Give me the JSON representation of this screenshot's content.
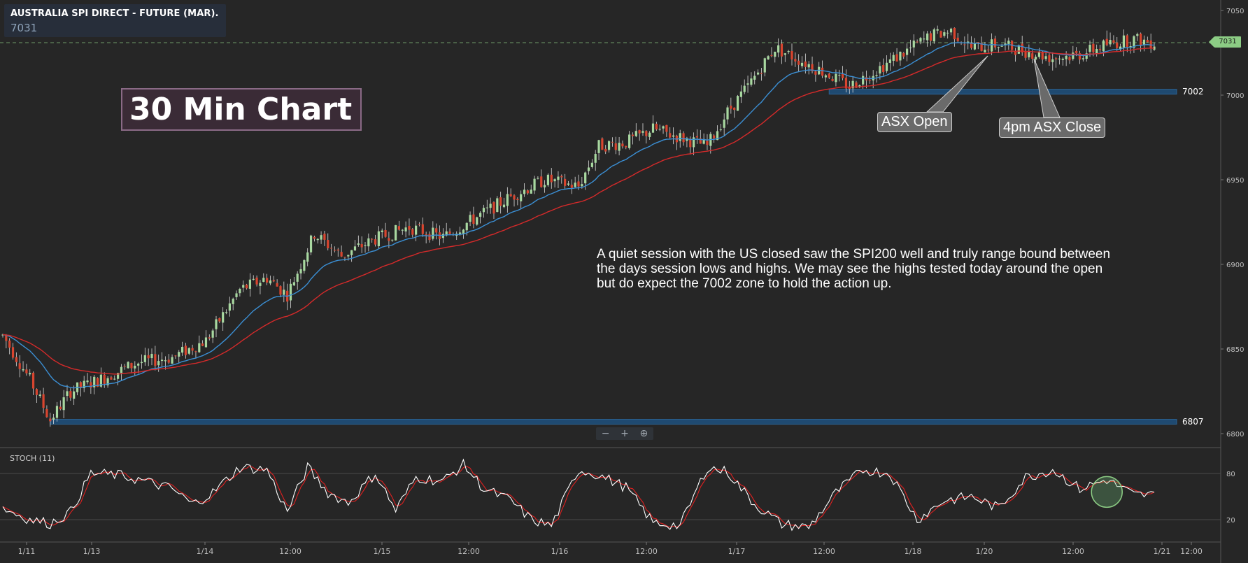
{
  "header": {
    "title": "AUSTRALIA SPI DIRECT - FUTURE (MAR).",
    "last_price": "7031"
  },
  "annotations": {
    "chart_label": "30 Min Chart",
    "commentary": [
      "A quiet session with the US closed saw the SPI200 well and truly range bound between",
      "the days session lows and highs. We may see the highs tested today around the open",
      "but do expect the 7002 zone to hold the action up."
    ],
    "asx_open": "ASX Open",
    "asx_close": "4pm ASX Close",
    "level_upper": "7002",
    "level_lower": "6807",
    "price_tag": "7031"
  },
  "zoom": {
    "minus": "−",
    "plus": "+",
    "magnify": "⊕"
  },
  "stoch": {
    "label": "STOCH (11)"
  },
  "colors": {
    "background": "#262626",
    "bull_candle": "#a8d8a0",
    "bear_candle": "#d9452f",
    "ema_fast": "#3b8fd4",
    "ema_slow": "#d42a2a",
    "stoch_k": "#ffffff",
    "stoch_d": "#e02020",
    "zone": "#1f4f7a",
    "last_price_line": "#8ccc84"
  },
  "chart_data": [
    {
      "type": "candlestick",
      "title": "AUSTRALIA SPI DIRECT - FUTURE (MAR).",
      "y_ticks": [
        6800,
        6850,
        6900,
        6950,
        7000,
        7050
      ],
      "ylim": [
        6800,
        7050
      ],
      "x_ticks": [
        "1/11",
        "1/13",
        "1/14",
        "12:00",
        "1/15",
        "12:00",
        "1/16",
        "12:00",
        "1/17",
        "12:00",
        "1/18",
        "1/20",
        "12:00",
        "1/21",
        "12:00"
      ],
      "close_path": [
        [
          0,
          6858
        ],
        [
          8,
          6832
        ],
        [
          14,
          6808
        ],
        [
          20,
          6825
        ],
        [
          30,
          6833
        ],
        [
          40,
          6842
        ],
        [
          50,
          6845
        ],
        [
          60,
          6855
        ],
        [
          70,
          6885
        ],
        [
          78,
          6892
        ],
        [
          84,
          6882
        ],
        [
          92,
          6918
        ],
        [
          100,
          6905
        ],
        [
          110,
          6915
        ],
        [
          120,
          6922
        ],
        [
          130,
          6916
        ],
        [
          140,
          6928
        ],
        [
          150,
          6940
        ],
        [
          160,
          6950
        ],
        [
          170,
          6946
        ],
        [
          176,
          6970
        ],
        [
          184,
          6972
        ],
        [
          192,
          6980
        ],
        [
          200,
          6975
        ],
        [
          208,
          6970
        ],
        [
          214,
          6990
        ],
        [
          220,
          7005
        ],
        [
          228,
          7028
        ],
        [
          236,
          7020
        ],
        [
          244,
          7012
        ],
        [
          250,
          7005
        ],
        [
          258,
          7015
        ],
        [
          266,
          7025
        ],
        [
          274,
          7035
        ],
        [
          280,
          7038
        ],
        [
          286,
          7028
        ],
        [
          294,
          7030
        ],
        [
          302,
          7026
        ],
        [
          310,
          7022
        ],
        [
          318,
          7024
        ],
        [
          326,
          7030
        ],
        [
          334,
          7033
        ],
        [
          340,
          7031
        ]
      ],
      "ema_fast_end": 7031,
      "ema_slow_end": 7026,
      "horizontal_levels": [
        7002,
        6807
      ],
      "last_price": 7031
    },
    {
      "type": "line",
      "title": "STOCH (11)",
      "y_ticks": [
        20,
        80
      ],
      "ylim": [
        0,
        100
      ],
      "k_path": [
        [
          0,
          35
        ],
        [
          8,
          20
        ],
        [
          14,
          15
        ],
        [
          20,
          30
        ],
        [
          26,
          80
        ],
        [
          34,
          78
        ],
        [
          42,
          70
        ],
        [
          50,
          60
        ],
        [
          56,
          40
        ],
        [
          62,
          55
        ],
        [
          70,
          88
        ],
        [
          78,
          85
        ],
        [
          84,
          30
        ],
        [
          90,
          88
        ],
        [
          96,
          55
        ],
        [
          102,
          42
        ],
        [
          110,
          80
        ],
        [
          116,
          32
        ],
        [
          122,
          75
        ],
        [
          130,
          70
        ],
        [
          136,
          92
        ],
        [
          142,
          60
        ],
        [
          150,
          45
        ],
        [
          156,
          20
        ],
        [
          162,
          12
        ],
        [
          170,
          85
        ],
        [
          176,
          78
        ],
        [
          184,
          62
        ],
        [
          192,
          16
        ],
        [
          200,
          12
        ],
        [
          208,
          88
        ],
        [
          214,
          82
        ],
        [
          222,
          40
        ],
        [
          230,
          14
        ],
        [
          238,
          10
        ],
        [
          246,
          55
        ],
        [
          254,
          85
        ],
        [
          262,
          80
        ],
        [
          270,
          20
        ],
        [
          278,
          45
        ],
        [
          286,
          50
        ],
        [
          294,
          35
        ],
        [
          302,
          75
        ],
        [
          310,
          85
        ],
        [
          318,
          60
        ],
        [
          326,
          72
        ],
        [
          334,
          52
        ]
      ]
    }
  ]
}
